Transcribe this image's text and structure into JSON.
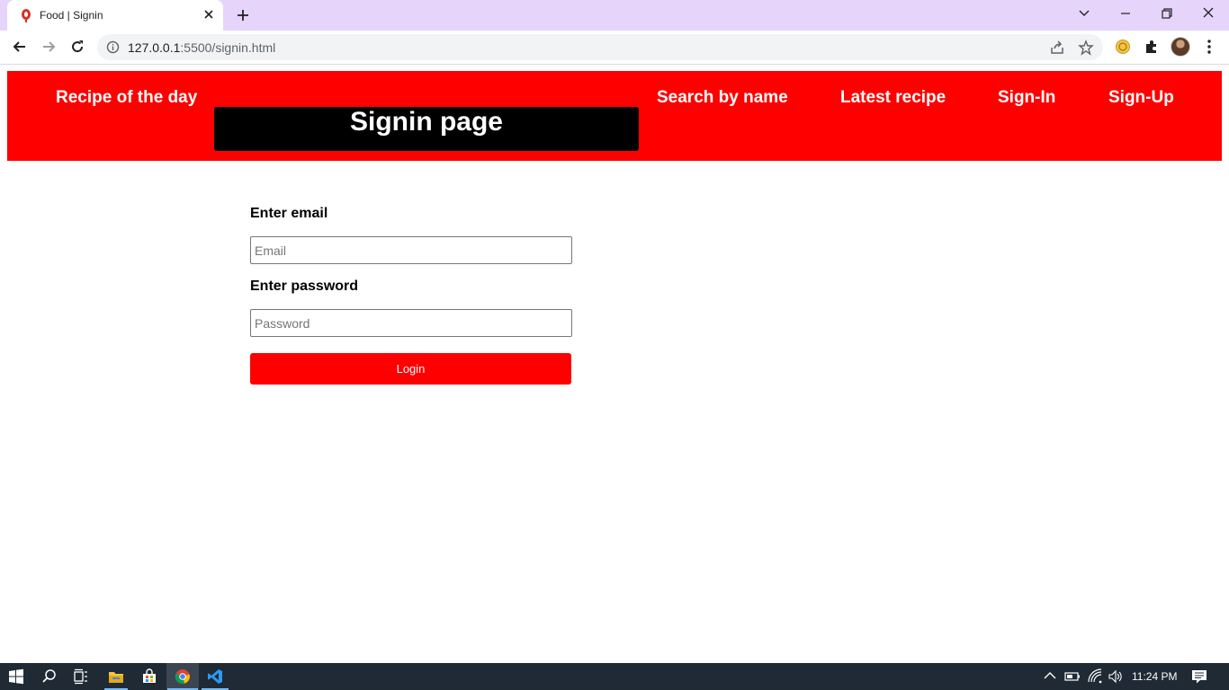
{
  "browser": {
    "tab_title": "Food | Signin",
    "url_host": "127.0.0.1",
    "url_path": ":5500/signin.html"
  },
  "navbar": {
    "recipe_of_day": "Recipe of the day",
    "page_heading": "Signin page",
    "search_by_name": "Search by name",
    "latest_recipe": "Latest recipe",
    "sign_in": "Sign-In",
    "sign_up": "Sign-Up",
    "color": "#ff0000"
  },
  "form": {
    "email_label": "Enter email",
    "email_placeholder": "Email",
    "password_label": "Enter password",
    "password_placeholder": "Password",
    "login_label": "Login"
  },
  "taskbar": {
    "time": "11:24 PM",
    "icons": [
      "windows-start-icon",
      "search-icon",
      "task-view-icon",
      "file-explorer-icon",
      "store-icon",
      "chrome-icon",
      "vscode-icon"
    ]
  }
}
